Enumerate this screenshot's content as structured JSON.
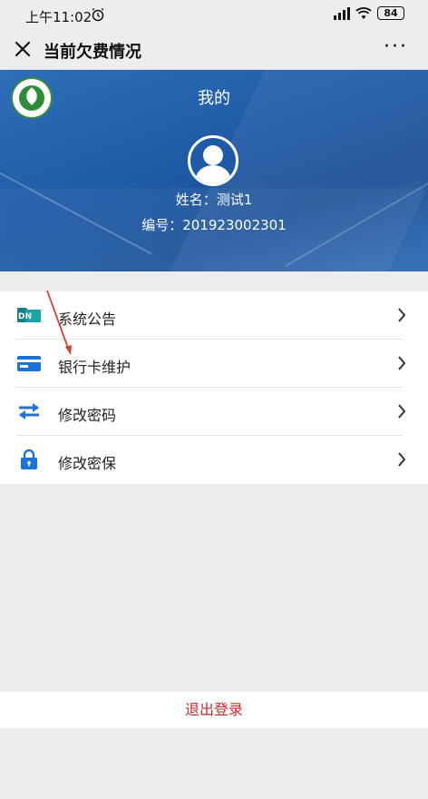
{
  "status_bar": {
    "time": "上午11:02",
    "battery": "84",
    "icons": [
      "alarm-icon",
      "signal-icon",
      "wifi-icon",
      "battery-icon"
    ]
  },
  "navbar": {
    "title": "当前欠费情况",
    "more": "···"
  },
  "profile": {
    "header": "我的",
    "name": "姓名：测试1",
    "code": "编号：201923002301"
  },
  "menu": [
    {
      "label": "系统公告",
      "icon": "announcement-icon"
    },
    {
      "label": "银行卡维护",
      "icon": "bank-card-icon"
    },
    {
      "label": "修改密码",
      "icon": "swap-arrows-icon"
    },
    {
      "label": "修改密保",
      "icon": "lock-icon"
    }
  ],
  "logout_label": "退出登录",
  "colors": {
    "banner": "#1f5aa6",
    "accent_blue": "#1a73d9",
    "logout_red": "#cc2b2b",
    "background": "#ededf0"
  }
}
